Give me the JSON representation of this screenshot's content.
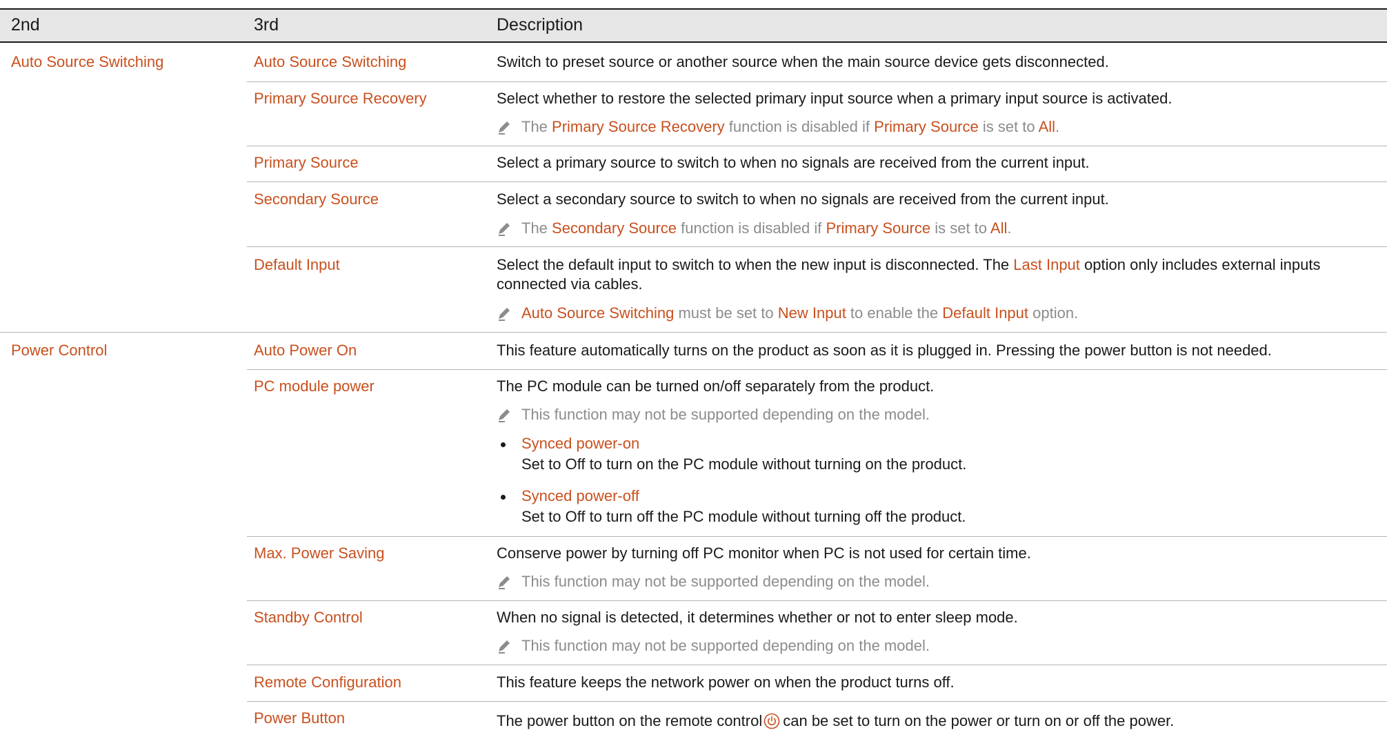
{
  "header": {
    "col2": "2nd",
    "col3": "3rd",
    "col4": "Description"
  },
  "rows": {
    "ass": {
      "second": "Auto Source Switching",
      "third": "Auto Source Switching",
      "desc": "Switch to preset source or another source when the main source device gets disconnected."
    },
    "psr": {
      "third": "Primary Source Recovery",
      "desc": "Select whether to restore the selected primary input source when a primary input source is activated.",
      "note": [
        "The ",
        "Primary Source Recovery",
        " function is disabled if ",
        "Primary Source",
        " is set to ",
        "All",
        "."
      ]
    },
    "ps": {
      "third": "Primary Source",
      "desc": "Select a primary source to switch to when no signals are received from the current input."
    },
    "ss": {
      "third": "Secondary Source",
      "desc": "Select a secondary source to switch to when no signals are received from the current input.",
      "note": [
        "The ",
        "Secondary Source",
        " function is disabled if ",
        "Primary Source",
        " is set to ",
        "All",
        "."
      ]
    },
    "di": {
      "third": "Default Input",
      "desc1": [
        "Select the default input to switch to when the new input is disconnected. The ",
        "Last Input",
        " option only includes external inputs"
      ],
      "desc2": "connected via cables.",
      "note": [
        "Auto Source Switching",
        " must be set to ",
        "New Input",
        " to enable the ",
        "Default Input",
        " option."
      ]
    },
    "apo": {
      "second": "Power Control",
      "third": "Auto Power On",
      "desc": "This feature automatically turns on the product as soon as it is plugged in. Pressing the power button is not needed."
    },
    "pcm": {
      "third": "PC module power",
      "desc": "The PC module can be turned on/off separately from the product.",
      "note": "This function may not be supported depending on the model.",
      "b1_title": "Synced power-on",
      "b1_text": "Set to Off to turn on the PC module without turning on the product.",
      "b2_title": "Synced power-off",
      "b2_text": "Set to Off to turn off the PC module without turning off the product."
    },
    "mps": {
      "third": "Max. Power Saving",
      "desc": "Conserve power by turning off PC monitor when PC is not used for certain time.",
      "note": "This function may not be supported depending on the model."
    },
    "sc": {
      "third": "Standby Control",
      "desc": "When no signal is detected, it determines whether or not to enter sleep mode.",
      "note": "This function may not be supported depending on the model."
    },
    "rc": {
      "third": "Remote Configuration",
      "desc": "This feature keeps the network power on when the product turns off."
    },
    "pb": {
      "third": "Power Button",
      "desc_a": "The power button on the remote control",
      "desc_b": "can be set to turn on the power or turn on or off the power."
    }
  },
  "colors": {
    "accent": "#c8501e",
    "note": "#8c8c8c",
    "text": "#1a1a1a",
    "header_bg": "#e6e6e6",
    "rule": "#b4b4b4"
  },
  "icons": {
    "note": "pencil-icon",
    "power": "power-icon",
    "bullet": "bullet-icon"
  }
}
